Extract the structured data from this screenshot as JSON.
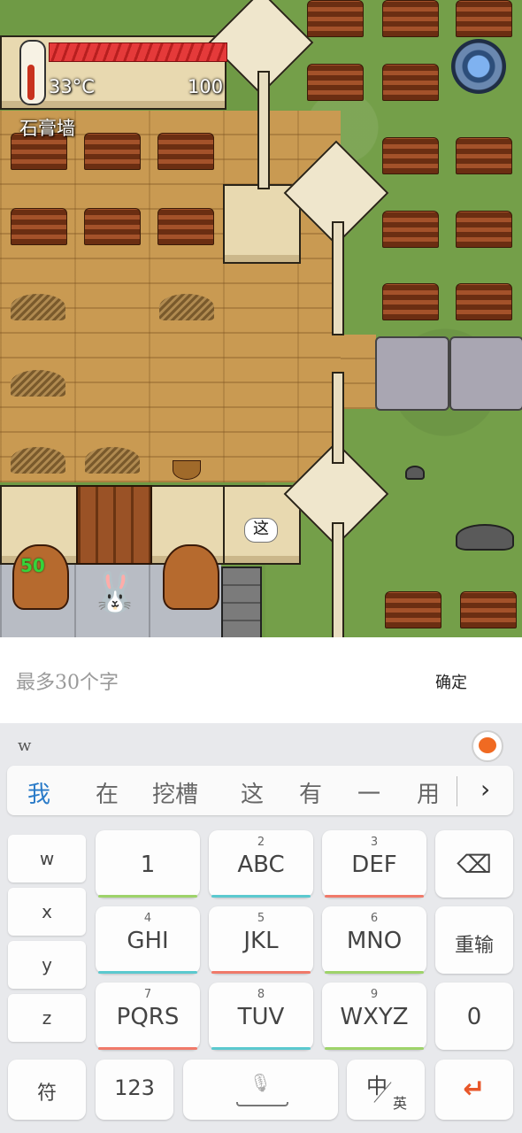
{
  "hud": {
    "temperature": "33°C",
    "health_value": "100",
    "selected_item": "石膏墙",
    "green_counter": "50",
    "speech_text": "这"
  },
  "input": {
    "placeholder": "最多30个字",
    "confirm_label": "确定"
  },
  "keyboard": {
    "pinyin": "w",
    "candidates": [
      "我",
      "在",
      "挖槽",
      "这",
      "有",
      "一",
      "用"
    ],
    "side_keys": [
      "w",
      "x",
      "y",
      "z"
    ],
    "keys_row1": [
      {
        "num": "",
        "label": "1",
        "accent": "#9ed36a"
      },
      {
        "num": "2",
        "label": "ABC",
        "accent": "#5bc9cf"
      },
      {
        "num": "3",
        "label": "DEF",
        "accent": "#f07a6a"
      }
    ],
    "keys_row2": [
      {
        "num": "4",
        "label": "GHI",
        "accent": "#5bc9cf"
      },
      {
        "num": "5",
        "label": "JKL",
        "accent": "#f07a6a"
      },
      {
        "num": "6",
        "label": "MNO",
        "accent": "#9ed36a"
      }
    ],
    "keys_row3": [
      {
        "num": "7",
        "label": "PQRS",
        "accent": "#f07a6a"
      },
      {
        "num": "8",
        "label": "TUV",
        "accent": "#5bc9cf"
      },
      {
        "num": "9",
        "label": "WXYZ",
        "accent": "#9ed36a"
      }
    ],
    "reenter_label": "重输",
    "zero_label": "0",
    "symbol_label": "符",
    "num_mode_label": "123",
    "lang_main": "中",
    "lang_sub": "英",
    "accent_orange": "#e8572a"
  }
}
